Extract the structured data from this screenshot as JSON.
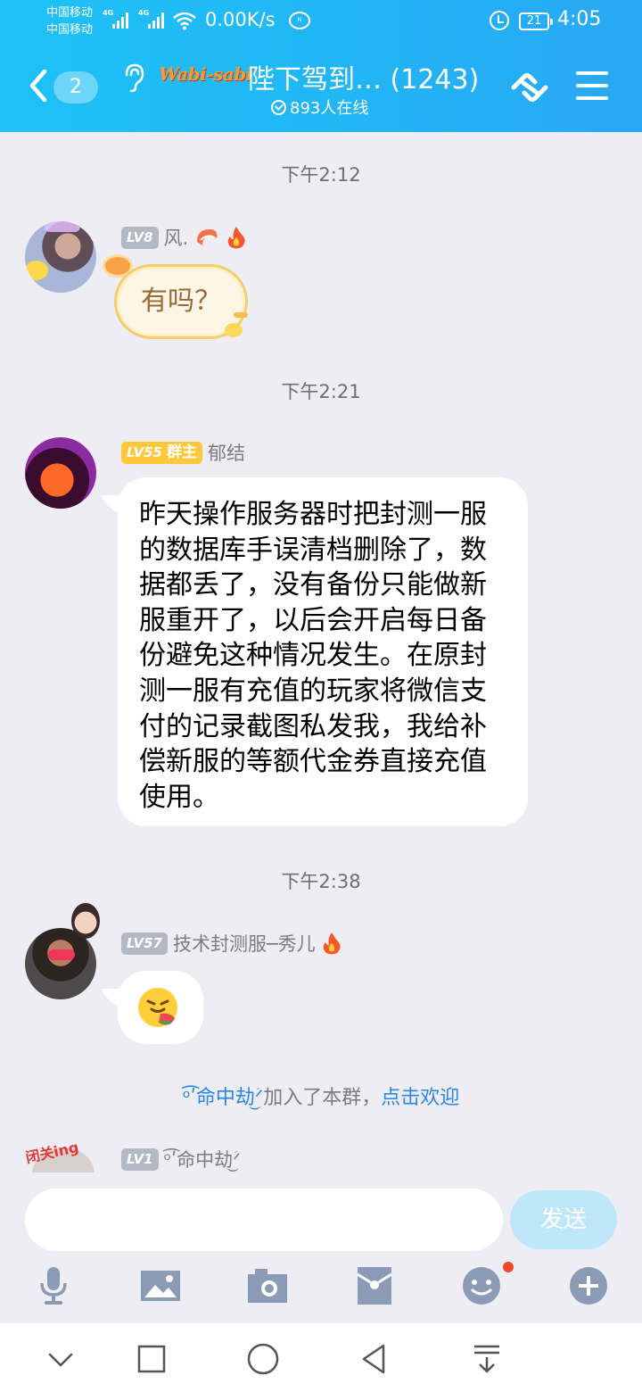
{
  "status_bar": {
    "carrier1": "中国移动",
    "carrier2": "中国移动",
    "net_type1": "4G",
    "net_type2": "4G",
    "net_speed": "0.00K/s",
    "battery": "21",
    "time": "4:05"
  },
  "header": {
    "unread_count": "2",
    "logo_text": "Wabi-sabi",
    "title": "陛下驾到…  (1243)",
    "online": "893人在线"
  },
  "messages": [
    {
      "time": "下午2:12",
      "level": "LV8",
      "name": "风.",
      "text": "有吗？"
    },
    {
      "time": "下午2:21",
      "level": "LV55",
      "role": "群主",
      "name": "郁结",
      "text": "昨天操作服务器时把封测一服的数据库手误清档删除了，数据都丢了，没有备份只能做新服重开了，以后会开启每日备份避免这种情况发生。在原封测一服有充值的玩家将微信支付的记录截图私发我，我给补偿新服的等额代金券直接充值使用。"
    },
    {
      "time": "下午2:38",
      "level": "LV57",
      "name": "技术封测服─秀儿",
      "text": ""
    },
    {
      "level": "LV1",
      "name": "ᵒ͡ʹ命中劫ؘ͜ᐟ"
    }
  ],
  "system_notice": {
    "user": "ᵒ͡ʹ命中劫ؘ͜ᐟ",
    "text": "加入了本群，",
    "action": "点击欢迎"
  },
  "input": {
    "placeholder": "",
    "send_label": "发送"
  },
  "avatar_tag": "闭关ing",
  "colors": {
    "header": "#1ec2f7",
    "background": "#ededf3",
    "link": "#2a86e8",
    "owner_badge": "#ffc83a",
    "send_button": "#bfe7fb"
  }
}
